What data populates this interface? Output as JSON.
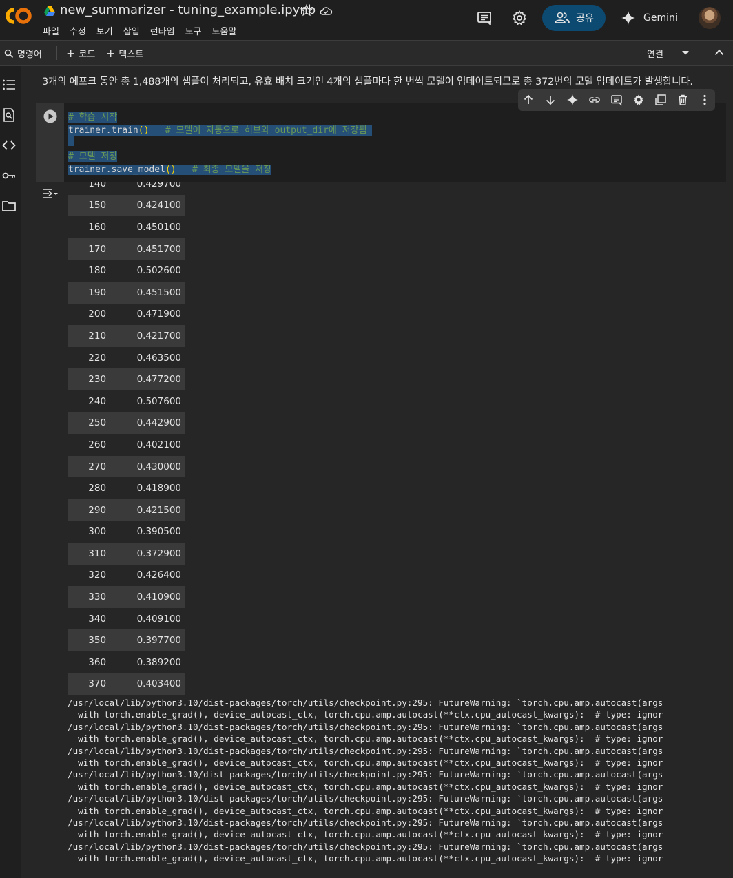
{
  "header": {
    "notebook_title": "new_summarizer - tuning_example.ipynb",
    "menu": [
      "파일",
      "수정",
      "보기",
      "삽입",
      "런타임",
      "도구",
      "도움말"
    ],
    "share_label": "공유",
    "gemini_label": "Gemini"
  },
  "toolbar": {
    "commands_label": "명령어",
    "add_code_label": "코드",
    "add_text_label": "텍스트",
    "connect_label": "연결"
  },
  "text_cell": "3개의 에포크 동안 총 1,488개의 샘플이 처리되고, 유효 배치 크기인 4개의 샘플마다 한 번씩 모델이 업데이트되므로 총 372번의 모델 업데이트가 발생합니다.",
  "code_cell": {
    "line1": "# 학습 시작",
    "line2_code": "trainer.train",
    "line2_paren": "()",
    "line2_comment": "# 모델이 자동으로 허브와 output_dir에 저장됨",
    "line4": "# 모델 저장",
    "line5_code": "trainer.save_model",
    "line5_paren": "()",
    "line5_comment": "# 최종 모델을 저장"
  },
  "training_log": [
    {
      "step": "140",
      "loss": "0.429700"
    },
    {
      "step": "150",
      "loss": "0.424100"
    },
    {
      "step": "160",
      "loss": "0.450100"
    },
    {
      "step": "170",
      "loss": "0.451700"
    },
    {
      "step": "180",
      "loss": "0.502600"
    },
    {
      "step": "190",
      "loss": "0.451500"
    },
    {
      "step": "200",
      "loss": "0.471900"
    },
    {
      "step": "210",
      "loss": "0.421700"
    },
    {
      "step": "220",
      "loss": "0.463500"
    },
    {
      "step": "230",
      "loss": "0.477200"
    },
    {
      "step": "240",
      "loss": "0.507600"
    },
    {
      "step": "250",
      "loss": "0.442900"
    },
    {
      "step": "260",
      "loss": "0.402100"
    },
    {
      "step": "270",
      "loss": "0.430000"
    },
    {
      "step": "280",
      "loss": "0.418900"
    },
    {
      "step": "290",
      "loss": "0.421500"
    },
    {
      "step": "300",
      "loss": "0.390500"
    },
    {
      "step": "310",
      "loss": "0.372900"
    },
    {
      "step": "320",
      "loss": "0.426400"
    },
    {
      "step": "330",
      "loss": "0.410900"
    },
    {
      "step": "340",
      "loss": "0.409100"
    },
    {
      "step": "350",
      "loss": "0.397700"
    },
    {
      "step": "360",
      "loss": "0.389200"
    },
    {
      "step": "370",
      "loss": "0.403400"
    }
  ],
  "warning_line1": "/usr/local/lib/python3.10/dist-packages/torch/utils/checkpoint.py:295: FutureWarning: `torch.cpu.amp.autocast(args",
  "warning_line2": "  with torch.enable_grad(), device_autocast_ctx, torch.cpu.amp.autocast(**ctx.cpu_autocast_kwargs):  # type: ignor",
  "colors": {
    "accent_share": "#0d4a72",
    "logo_orange": "#f9ab00",
    "logo_orange2": "#e8710a",
    "comment_green": "#6a9955",
    "selection_blue": "#264f78"
  }
}
